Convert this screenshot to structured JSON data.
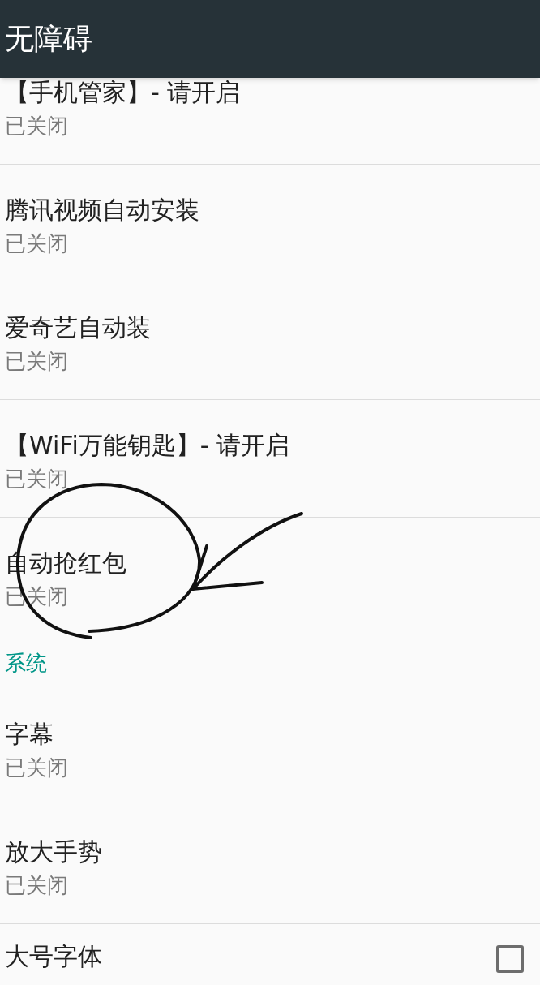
{
  "toolbar": {
    "title": "无障碍"
  },
  "sections": [
    {
      "items": [
        {
          "kind": "text",
          "title": "【手机管家】- 请开启",
          "summary": "已关闭"
        },
        {
          "kind": "text",
          "title": "腾讯视频自动安装",
          "summary": "已关闭"
        },
        {
          "kind": "text",
          "title": "爱奇艺自动装",
          "summary": "已关闭"
        },
        {
          "kind": "text",
          "title": "【WiFi万能钥匙】- 请开启",
          "summary": "已关闭"
        },
        {
          "kind": "text",
          "title": "自动抢红包",
          "summary": "已关闭"
        }
      ]
    },
    {
      "header": "系统",
      "items": [
        {
          "kind": "text",
          "title": "字幕",
          "summary": "已关闭"
        },
        {
          "kind": "text",
          "title": "放大手势",
          "summary": "已关闭"
        },
        {
          "kind": "checkbox",
          "title": "大号字体",
          "checked": false
        }
      ]
    }
  ]
}
